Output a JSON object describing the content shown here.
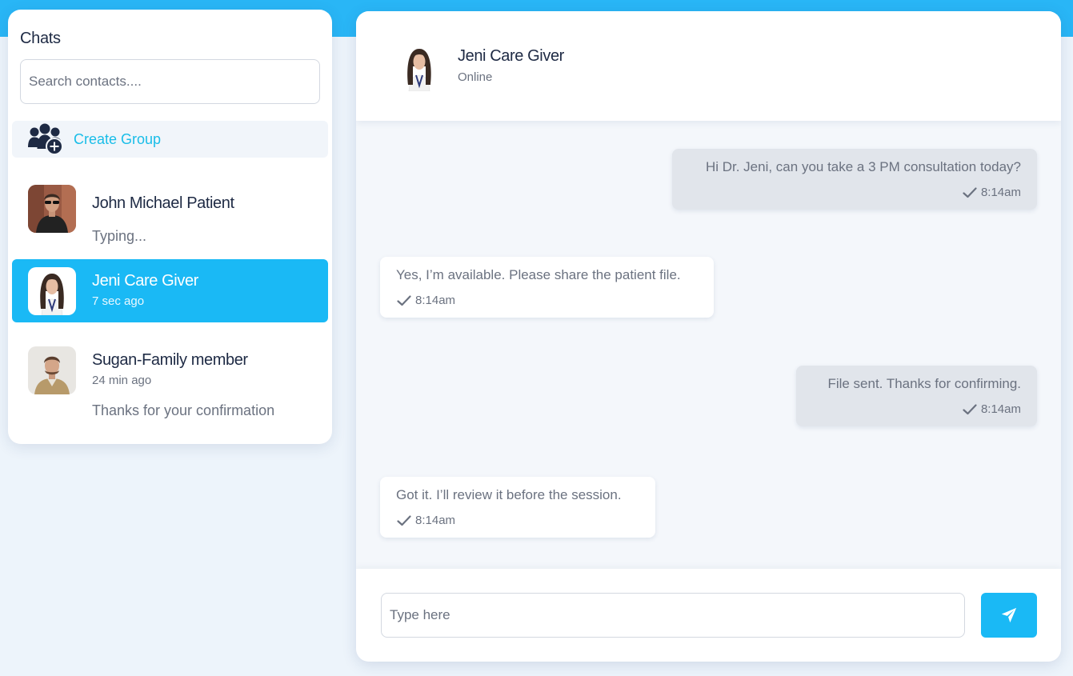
{
  "sidebar": {
    "title": "Chats",
    "search_placeholder": "Search contacts....",
    "create_group_label": "Create Group",
    "contacts": [
      {
        "name": "John Michael Patient",
        "message": "Typing..."
      },
      {
        "name": "Jeni Care Giver",
        "time": "7 sec ago"
      },
      {
        "name": "Sugan-Family member",
        "time": "24 min ago",
        "message": "Thanks for your confirmation"
      }
    ]
  },
  "chat": {
    "header": {
      "name": "Jeni Care Giver",
      "status": "Online"
    },
    "messages": [
      {
        "direction": "sent",
        "text": "Hi Dr. Jeni, can you take a 3 PM consultation today?",
        "time": "8:14am"
      },
      {
        "direction": "received",
        "text": "Yes, I’m available. Please share the patient file.",
        "time": "8:14am"
      },
      {
        "direction": "sent",
        "text": "File sent. Thanks for confirming.",
        "time": "8:14am"
      },
      {
        "direction": "received",
        "text": "Got it. I’ll review it before the session.",
        "time": "8:14am"
      }
    ],
    "composer_placeholder": "Type here"
  },
  "colors": {
    "accent": "#1ab9f5",
    "top_band": "#29b6f6",
    "text_dark": "#1e2a44",
    "text_muted": "#6b7280",
    "sent_bubble": "#e1e5eb"
  },
  "icons": {
    "create_group": "group-add-icon",
    "check": "check-icon",
    "send": "send-icon"
  }
}
